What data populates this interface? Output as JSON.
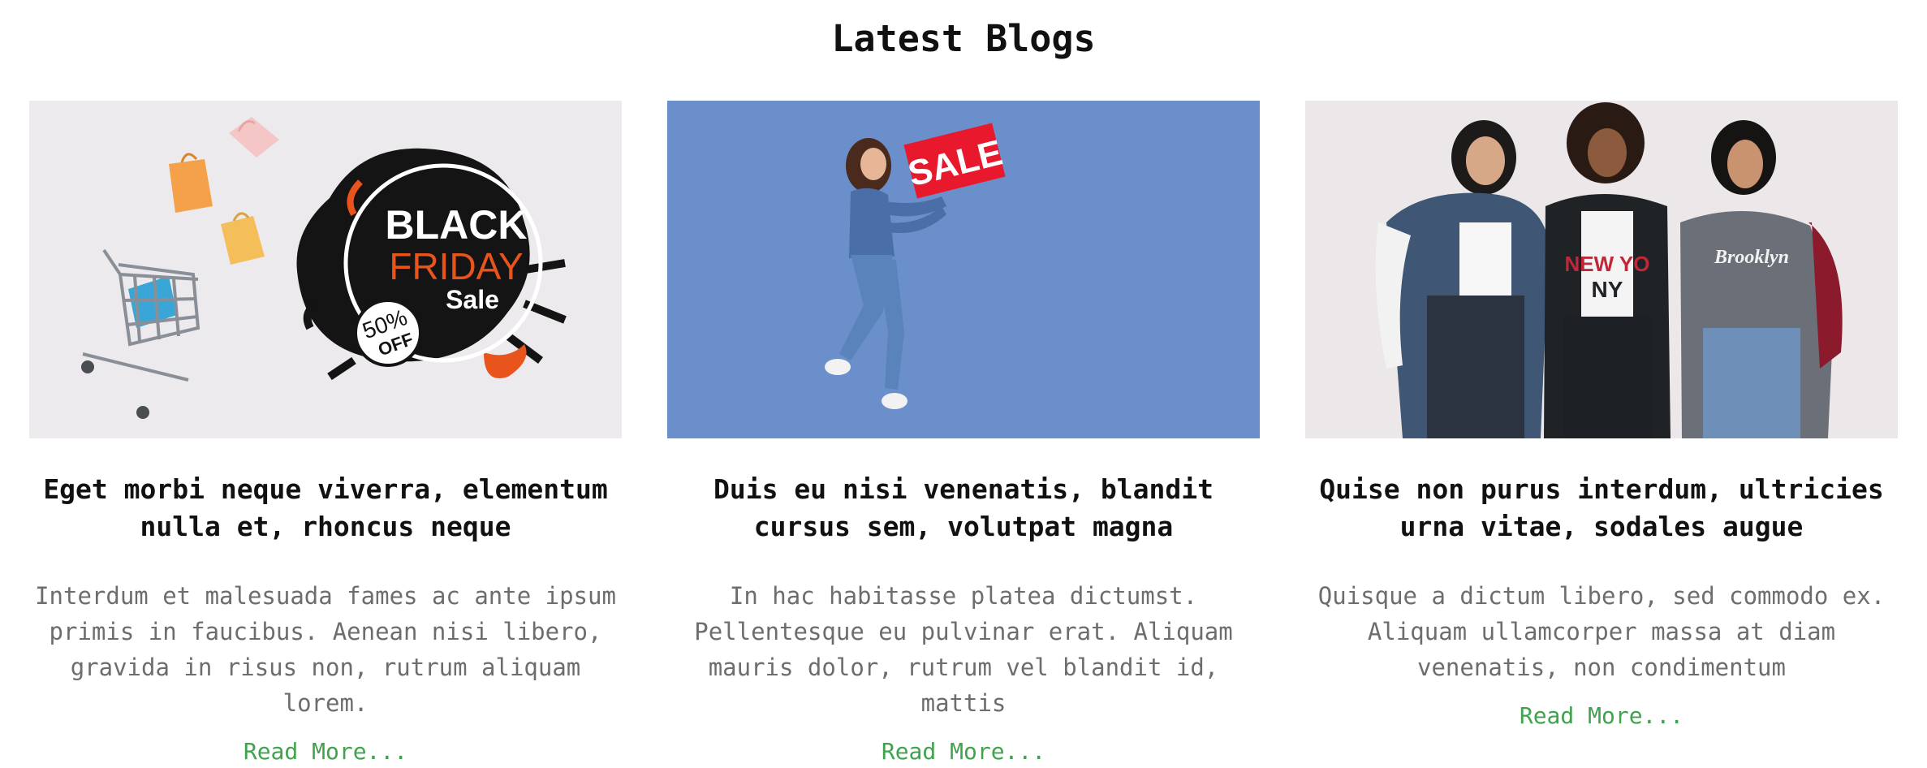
{
  "section": {
    "title": "Latest Blogs"
  },
  "posts": [
    {
      "title": "Eget morbi neque viverra, elementum nulla et, rhoncus neque",
      "excerpt": "Interdum et malesuada fames ac ante ipsum primis in faucibus. Aenean nisi libero, gravida in risus non, rutrum aliquam lorem.",
      "read_more": "Read More...",
      "image": {
        "badge_line1": "BLACK",
        "badge_line2": "FRIDAY",
        "badge_line3": "Sale",
        "discount_line1": "50%",
        "discount_line2": "OFF"
      }
    },
    {
      "title": "Duis eu nisi venenatis, blandit cursus sem, volutpat magna",
      "excerpt": "In hac habitasse platea dictumst. Pellentesque eu pulvinar erat. Aliquam mauris dolor, rutrum vel blandit id, mattis",
      "read_more": "Read More...",
      "image": {
        "sign_text": "SALE"
      }
    },
    {
      "title": "Quise non purus interdum, ultricies urna vitae, sodales augue",
      "excerpt": "Quisque a dictum libero, sed commodo ex. Aliquam ullamcorper massa at diam venenatis, non condimentum",
      "read_more": "Read More...",
      "image": {
        "shirt_text_1": "NEW YO",
        "shirt_text_2": "NY",
        "shirt_text_3": "Brooklyn"
      }
    }
  ],
  "colors": {
    "link": "#3fa34d",
    "excerpt": "#6d6d6d",
    "title": "#111111",
    "card2_bg": "#6b8fcb",
    "sale_red": "#e8192c",
    "friday_orange": "#e8541c"
  }
}
